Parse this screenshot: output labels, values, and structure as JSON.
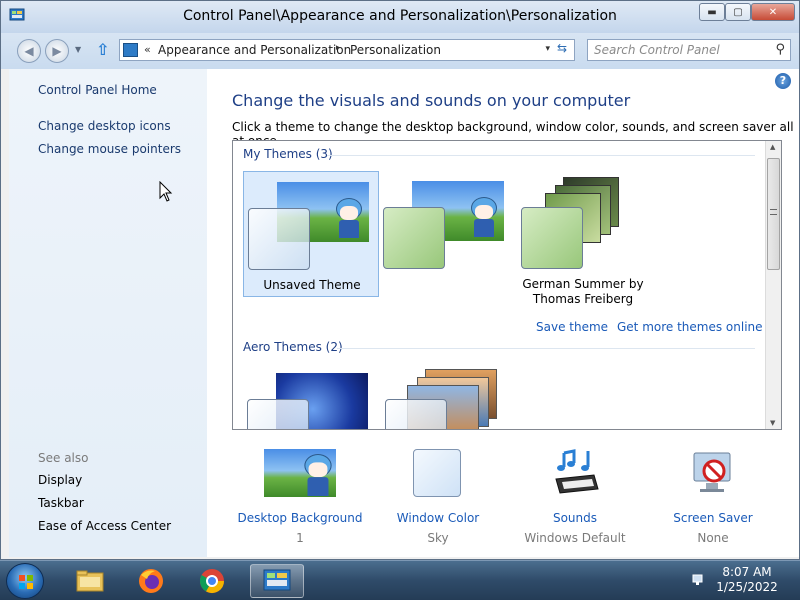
{
  "window": {
    "title": "Control Panel\\Appearance and Personalization\\Personalization",
    "buttons": {
      "minimize": "▬",
      "maximize": "▢",
      "close": "✕"
    }
  },
  "address": {
    "overflow": "«",
    "crumbs": [
      "Appearance and Personalization",
      "Personalization"
    ],
    "separator": "▸",
    "dropdown": "▾",
    "refresh": "⇆"
  },
  "search": {
    "placeholder": "Search Control Panel",
    "icon": "⚲"
  },
  "left_pane": {
    "home": "Control Panel Home",
    "links": [
      "Change desktop icons",
      "Change mouse pointers"
    ],
    "see_also_title": "See also",
    "see_also": [
      "Display",
      "Taskbar",
      "Ease of Access Center"
    ]
  },
  "main": {
    "help": "?",
    "heading": "Change the visuals and sounds on your computer",
    "subheading": "Click a theme to change the desktop background, window color, sounds, and screen saver all at once.",
    "my_themes_header": "My Themes (3)",
    "aero_themes_header": "Aero Themes (2)",
    "themes": [
      {
        "label": "Unsaved Theme",
        "selected": true
      },
      {
        "label": "",
        "selected": false
      },
      {
        "label_line1": "German Summer by",
        "label_line2": "Thomas Freiberg",
        "selected": false
      }
    ],
    "save_theme": "Save theme",
    "get_more": "Get more themes online"
  },
  "bottom": [
    {
      "label": "Desktop Background",
      "value": "1"
    },
    {
      "label": "Window Color",
      "value": "Sky"
    },
    {
      "label": "Sounds",
      "value": "Windows Default"
    },
    {
      "label": "Screen Saver",
      "value": "None"
    }
  ],
  "taskbar": {
    "time": "8:07 AM",
    "date": "1/25/2022",
    "apps": [
      "explorer-icon",
      "firefox-icon",
      "chrome-icon",
      "control-panel-icon"
    ]
  },
  "colors": {
    "link": "#1a5ab8",
    "heading": "#1e3f86",
    "selection": "#dcebfc"
  }
}
